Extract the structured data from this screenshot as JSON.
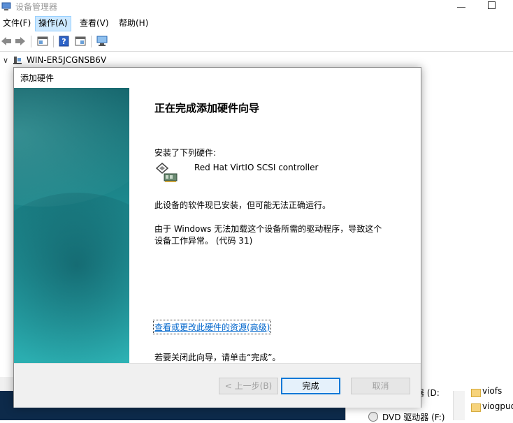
{
  "window": {
    "title": "设备管理器",
    "menu": [
      "文件(F)",
      "操作(A)",
      "查看(V)",
      "帮助(H)"
    ],
    "tree_root": "WIN-ER5JCGNSB6V",
    "files": {
      "item1": "viofs",
      "item2": "viogpudo",
      "drive1": "器 (D:",
      "drive2": "DVD 驱动器 (F:)"
    }
  },
  "dialog": {
    "title": "添加硬件",
    "heading": "正在完成添加硬件向导",
    "installed_label": "安装了下列硬件:",
    "device_name": "Red Hat VirtIO SCSI controller",
    "status_line": "此设备的软件现已安装，但可能无法正确运行。",
    "error_line1": "由于 Windows 无法加载这个设备所需的驱动程序，导致这个",
    "error_line2": "设备工作异常。 (代码 31)",
    "link": "查看或更改此硬件的资源(高级)",
    "close_hint": "若要关闭此向导，请单击“完成”。",
    "buttons": {
      "back": "< 上一步(B)",
      "finish": "完成",
      "cancel": "取消"
    }
  },
  "colors": {
    "accent": "#0078d7",
    "link": "#0066cc",
    "banner": "#1a7f84"
  }
}
